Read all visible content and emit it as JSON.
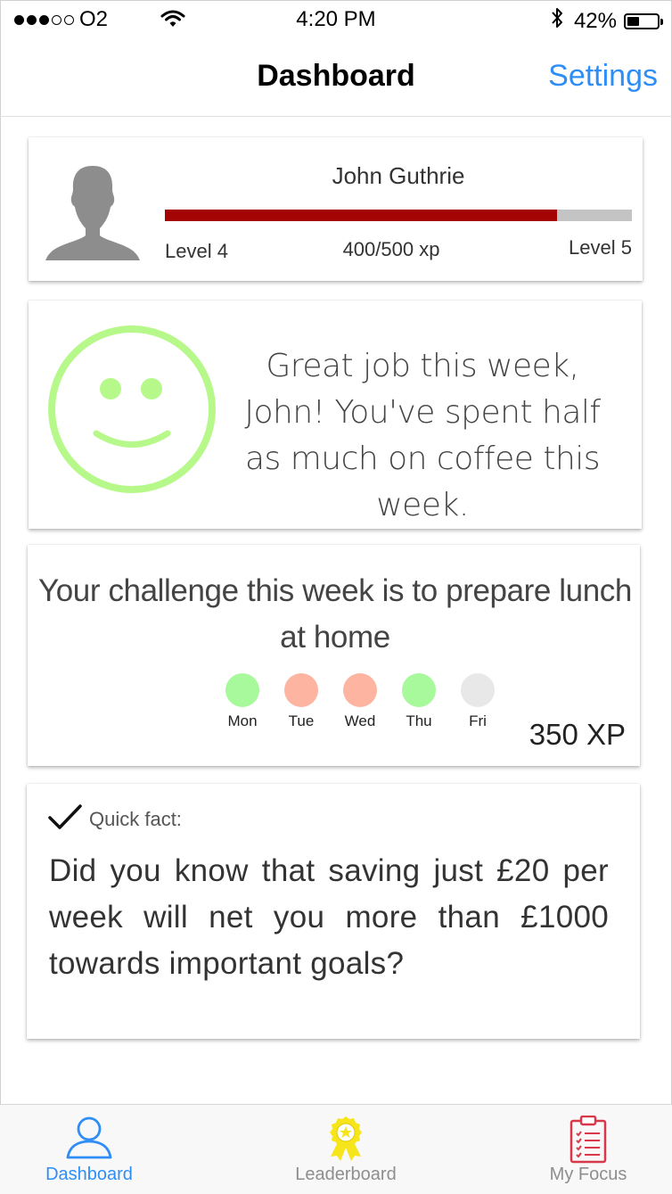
{
  "status_bar": {
    "carrier": "O2",
    "time": "4:20 PM",
    "battery_percent": "42%",
    "battery_level": 0.42
  },
  "nav": {
    "title": "Dashboard",
    "settings_label": "Settings"
  },
  "profile": {
    "name": "John Guthrie",
    "level_current": "Level 4",
    "level_next": "Level 5",
    "xp_text": "400/500 xp",
    "xp_progress": 0.84,
    "xp_bar_color": "#a40404"
  },
  "mood": {
    "message": "Great job this week, John! You've spent half as much on coffee this week.",
    "smiley_color": "#b6f98a"
  },
  "challenge": {
    "text": "Your challenge this week is to prepare lunch at home",
    "xp": "350 XP",
    "days": [
      {
        "label": "Mon",
        "color": "#a7f99b"
      },
      {
        "label": "Tue",
        "color": "#fdb5a1"
      },
      {
        "label": "Wed",
        "color": "#fdb5a1"
      },
      {
        "label": "Thu",
        "color": "#a7f99b"
      },
      {
        "label": "Fri",
        "color": "#e8e8e8"
      }
    ]
  },
  "fact": {
    "label": "Quick fact:",
    "text": "Did you know that saving just £20 per week will net you more than £1000 towards important goals?"
  },
  "tabs": [
    {
      "label": "Dashboard",
      "icon": "person-icon",
      "active": true
    },
    {
      "label": "Leaderboard",
      "icon": "award-ribbon-icon",
      "active": false
    },
    {
      "label": "My Focus",
      "icon": "clipboard-checklist-icon",
      "active": false
    }
  ],
  "colors": {
    "accent": "#2f8ef5",
    "award": "#f7e51b",
    "focus_icon": "#d9384a"
  }
}
